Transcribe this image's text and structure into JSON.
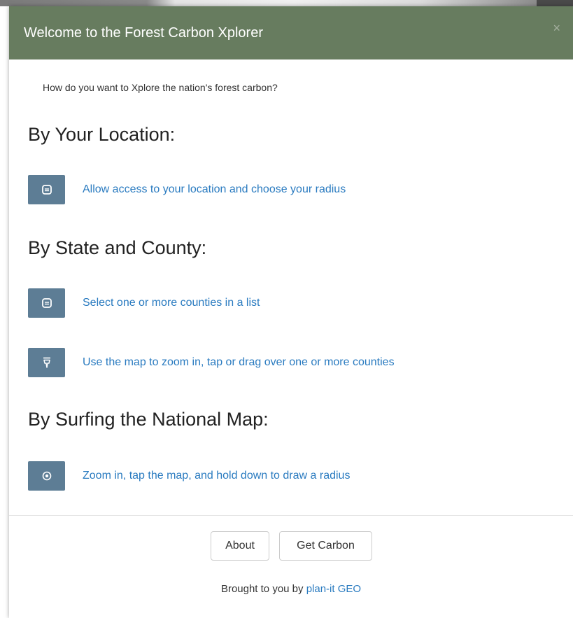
{
  "modal": {
    "title": "Welcome to the Forest Carbon Xplorer",
    "close_label": "×",
    "intro": "How do you want to Xplore the nation's forest carbon?"
  },
  "sections": [
    {
      "heading": "By Your Location:",
      "options": [
        {
          "icon": "location-icon",
          "label": "Allow access to your location and choose your radius"
        }
      ]
    },
    {
      "heading": "By State and County:",
      "options": [
        {
          "icon": "list-icon",
          "label": "Select one or more counties in a list"
        },
        {
          "icon": "pointer-icon",
          "label": "Use the map to zoom in, tap or drag over one or more counties"
        }
      ]
    },
    {
      "heading": "By Surfing the National Map:",
      "options": [
        {
          "icon": "radius-icon",
          "label": "Zoom in, tap the map, and hold down to draw a radius"
        }
      ]
    }
  ],
  "footer": {
    "about_label": "About",
    "get_carbon_label": "Get Carbon",
    "credit_prefix": "Brought to you by",
    "credit_link": "plan-it GEO"
  },
  "colors": {
    "header_bg": "#677c5f",
    "icon_button_bg": "#5d7d95",
    "link": "#2a7bc0"
  }
}
